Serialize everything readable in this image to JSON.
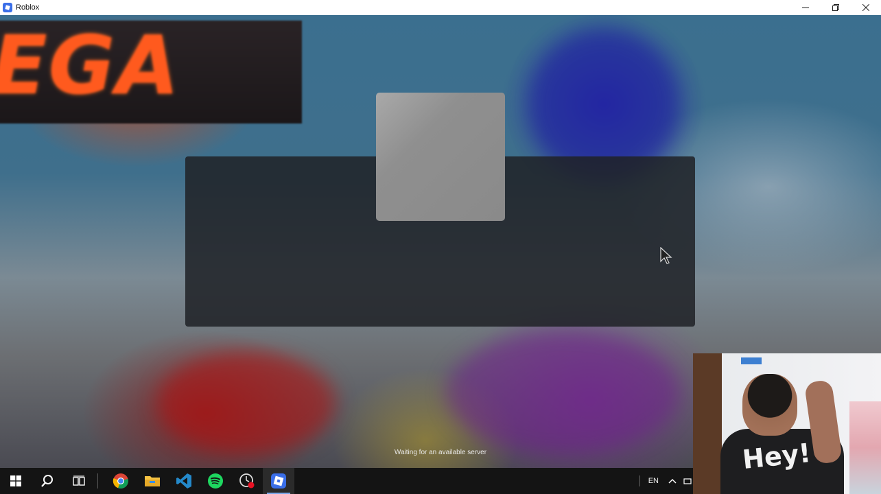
{
  "window": {
    "title": "Roblox",
    "icon": "roblox-icon",
    "controls": [
      "minimize-icon",
      "restore-icon",
      "close-icon"
    ]
  },
  "game": {
    "sign_text": "EGA",
    "status_text": "Waiting for an available server"
  },
  "webcam": {
    "shirt_text": "Hey!"
  },
  "taskbar": {
    "items": [
      {
        "name": "start-button",
        "icon": "windows-icon"
      },
      {
        "name": "search-button",
        "icon": "search-icon"
      },
      {
        "name": "task-view-button",
        "icon": "task-view-icon"
      },
      {
        "name": "chrome-app",
        "icon": "chrome-icon"
      },
      {
        "name": "file-explorer-app",
        "icon": "folder-icon"
      },
      {
        "name": "vscode-app",
        "icon": "vscode-icon"
      },
      {
        "name": "spotify-app",
        "icon": "spotify-icon"
      },
      {
        "name": "recorder-app",
        "icon": "recorder-icon"
      },
      {
        "name": "roblox-app",
        "icon": "roblox-icon",
        "active": true
      }
    ],
    "tray": {
      "language": "EN"
    }
  },
  "colors": {
    "accent": "#3a6ee8",
    "taskbar": "#141414",
    "panel": "#202226"
  }
}
